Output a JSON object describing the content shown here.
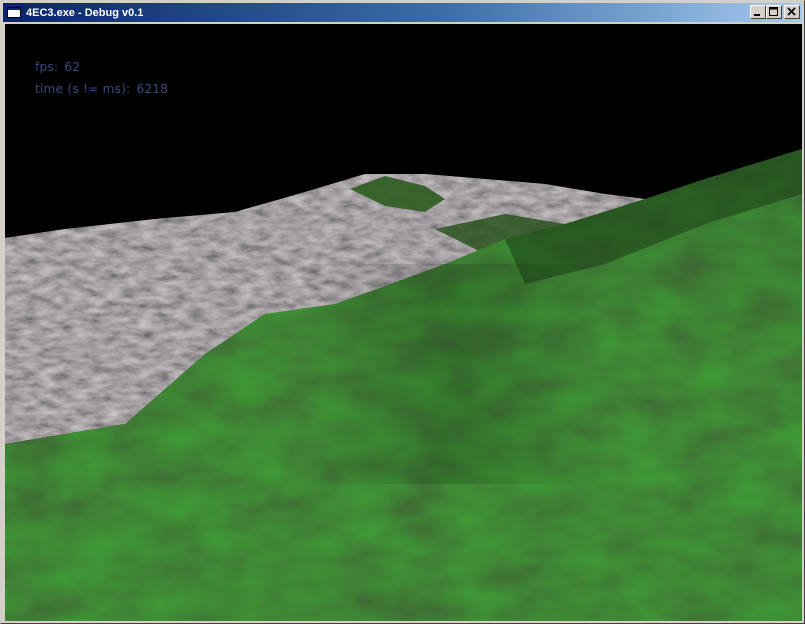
{
  "window": {
    "title": "4EC3.exe - Debug v0.1",
    "titlebar_color": "#0a246a"
  },
  "hud": {
    "fps_label": "fps:",
    "fps_value": "62",
    "time_label": "time (s != ms):",
    "time_value": "6218",
    "text_color": "#3a4a7c"
  },
  "scene": {
    "background_color": "#000000",
    "rock_color": "#6b6560",
    "grass_color": "#2e5a22"
  }
}
